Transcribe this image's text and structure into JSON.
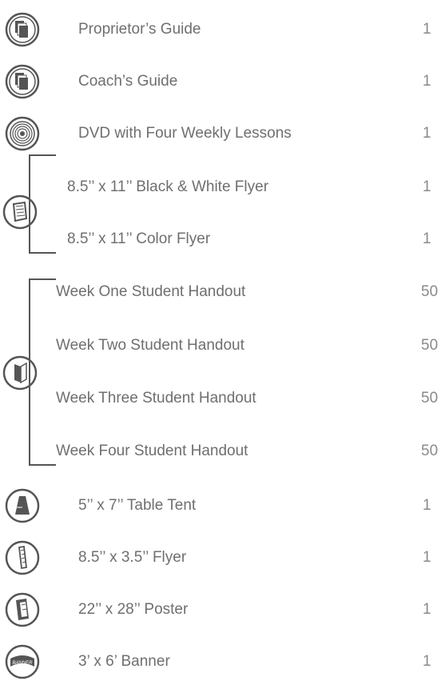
{
  "items": [
    {
      "label": "Proprietor’s Guide",
      "qty": "1",
      "icon": "stacked-pages-icon"
    },
    {
      "label": "Coach’s Guide",
      "qty": "1",
      "icon": "stacked-pages-icon"
    },
    {
      "label": "DVD with Four Weekly Lessons",
      "qty": "1",
      "icon": "dvd-icon"
    },
    {
      "label": "8.5’’ x 11’’ Black & White Flyer",
      "qty": "1",
      "icon": "flyer-icon"
    },
    {
      "label": "8.5’’ x 11’’ Color Flyer",
      "qty": "1",
      "icon": "flyer-icon"
    },
    {
      "label": "Week One Student Handout",
      "qty": "50",
      "icon": "handout-icon"
    },
    {
      "label": "Week Two Student Handout",
      "qty": "50",
      "icon": "handout-icon"
    },
    {
      "label": "Week Three Student Handout",
      "qty": "50",
      "icon": "handout-icon"
    },
    {
      "label": "Week Four Student Handout",
      "qty": "50",
      "icon": "handout-icon"
    },
    {
      "label": "5’’ x 7’’ Table Tent",
      "qty": "1",
      "icon": "table-tent-icon"
    },
    {
      "label": "8.5’’ x 3.5’’ Flyer",
      "qty": "1",
      "icon": "narrow-flyer-icon"
    },
    {
      "label": "22’’ x 28’’ Poster",
      "qty": "1",
      "icon": "poster-icon"
    },
    {
      "label": "3’ x 6’ Banner",
      "qty": "1",
      "icon": "banner-icon"
    }
  ],
  "banner_icon_text": "BANNER",
  "colors": {
    "text": "#6f6f6f",
    "icon": "#555555"
  }
}
